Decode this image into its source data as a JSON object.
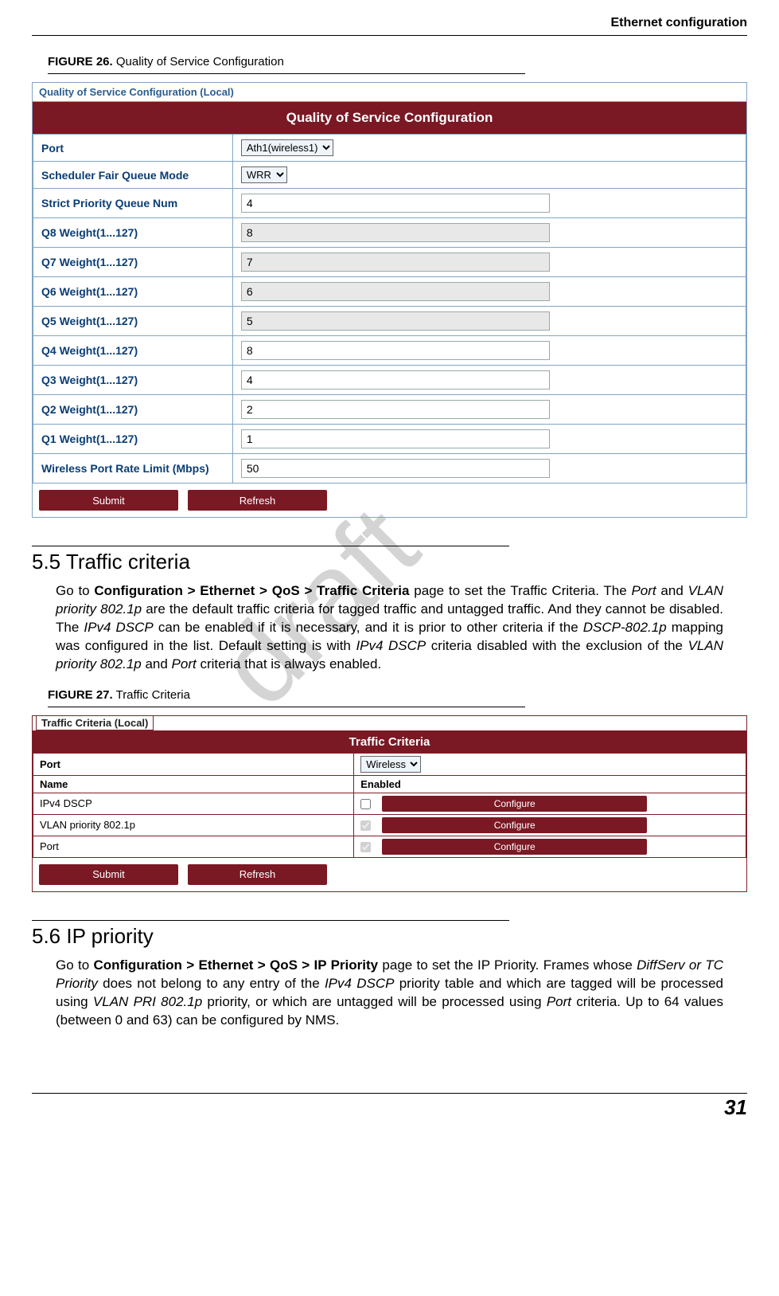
{
  "page": {
    "header": "Ethernet configuration",
    "number": "31",
    "watermark": "draft"
  },
  "fig26": {
    "caption_num": "FIGURE 26.",
    "caption_text": " Quality of Service Configuration",
    "legend": "Quality of Service Configuration (Local)",
    "title": "Quality of Service Configuration",
    "rows": {
      "port_l": "Port",
      "port_v": "Ath1(wireless1)",
      "sched_l": "Scheduler Fair Queue Mode",
      "sched_v": "WRR",
      "spqn_l": "Strict Priority Queue Num",
      "spqn_v": "4",
      "q8_l": "Q8 Weight(1...127)",
      "q8_v": "8",
      "q7_l": "Q7 Weight(1...127)",
      "q7_v": "7",
      "q6_l": "Q6 Weight(1...127)",
      "q6_v": "6",
      "q5_l": "Q5 Weight(1...127)",
      "q5_v": "5",
      "q4_l": "Q4 Weight(1...127)",
      "q4_v": "8",
      "q3_l": "Q3 Weight(1...127)",
      "q3_v": "4",
      "q2_l": "Q2 Weight(1...127)",
      "q2_v": "2",
      "q1_l": "Q1 Weight(1...127)",
      "q1_v": "1",
      "rate_l": "Wireless Port Rate Limit (Mbps)",
      "rate_v": "50"
    },
    "submit": "Submit",
    "refresh": "Refresh"
  },
  "s55": {
    "heading": "5.5 Traffic criteria",
    "p": {
      "a": "Go to ",
      "b": "Configuration > Ethernet > QoS > Traffic Criteria",
      "c": " page to set the Traffic Criteria. The ",
      "d": "Port",
      "e": " and ",
      "f": "VLAN priority 802.1p",
      "g": " are the default traffic criteria for tagged traffic and untagged traffic. And they cannot be disabled. The ",
      "h": "IPv4 DSCP",
      "i": " can be enabled if it is necessary, and it is prior to other criteria if the ",
      "j": "DSCP-802.1p",
      "k": " mapping was configured in the list. Default setting is with ",
      "l": "IPv4 DSCP",
      "m": " criteria disabled with the exclusion of the ",
      "n": "VLAN priority 802.1p",
      "o": " and ",
      "p": "Port",
      "q": " criteria that is always enabled."
    }
  },
  "fig27": {
    "caption_num": "FIGURE 27.",
    "caption_text": " Traffic Criteria",
    "legend": "Traffic Criteria (Local)",
    "title": "Traffic Criteria",
    "port_l": "Port",
    "port_v": "Wireless",
    "name_h": "Name",
    "en_h": "Enabled",
    "r1": "IPv4 DSCP",
    "r2": "VLAN priority 802.1p",
    "r3": "Port",
    "conf": "Configure",
    "submit": "Submit",
    "refresh": "Refresh"
  },
  "s56": {
    "heading": "5.6 IP priority",
    "p": {
      "a": "Go to ",
      "b": "Configuration > Ethernet > QoS > IP Priority",
      "c": " page to set the IP Priority. Frames whose ",
      "d": "DiffServ or TC Priority",
      "e": " does not belong to any entry of the ",
      "f": "IPv4 DSCP",
      "g": " priority table and which are tagged will be processed using ",
      "h": "VLAN PRI 802.1p",
      "i": " priority, or which are untagged will be processed using ",
      "j": "Port",
      "k": " criteria. Up to 64 values (between 0 and 63) can be configured by NMS."
    }
  }
}
